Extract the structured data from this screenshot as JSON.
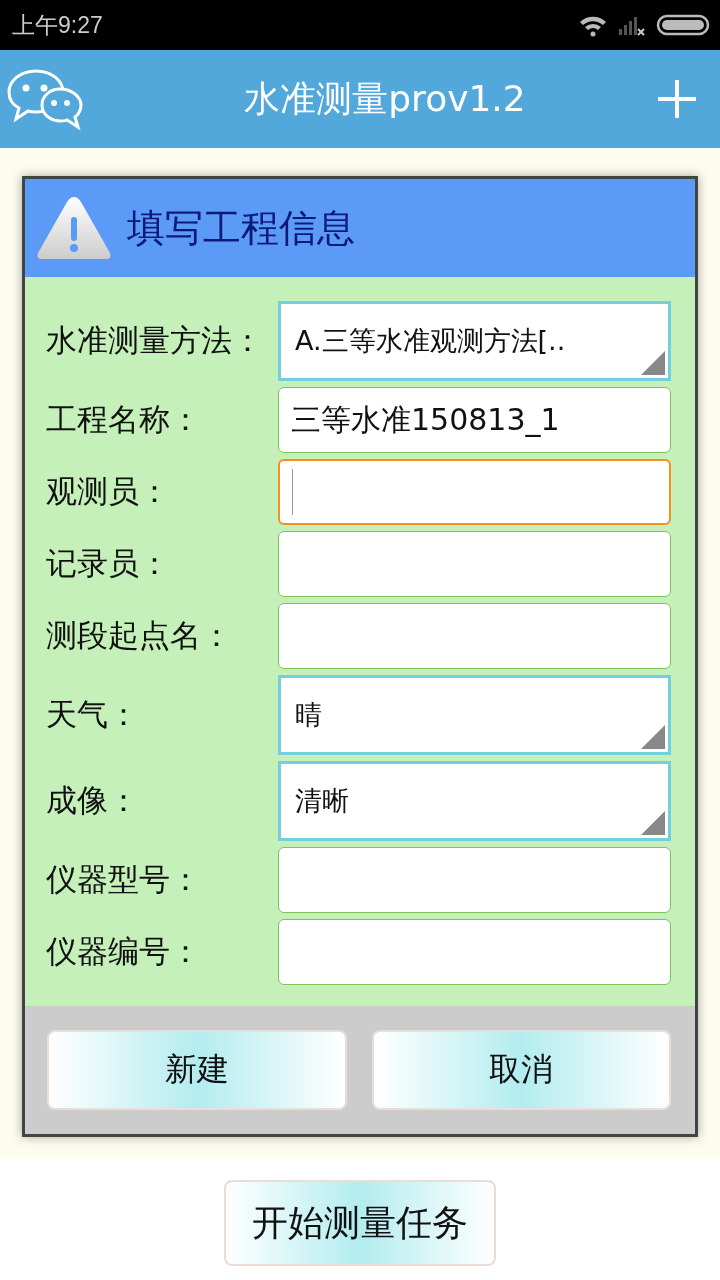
{
  "status_bar": {
    "time": "上午9:27"
  },
  "app_bar": {
    "title": "水准测量prov1.2"
  },
  "dialog": {
    "title": "填写工程信息",
    "fields": [
      {
        "label": "水准测量方法：",
        "kind": "select",
        "value": "A.三等水准观测方法[..",
        "focused": false
      },
      {
        "label": "工程名称：",
        "kind": "text",
        "value": "三等水准150813_1",
        "focused": false
      },
      {
        "label": "观测员：",
        "kind": "text",
        "focused": true
      },
      {
        "label": "记录员：",
        "kind": "text",
        "focused": false
      },
      {
        "label": "测段起点名：",
        "kind": "text",
        "focused": false
      },
      {
        "label": "天气：",
        "kind": "select",
        "value": "晴",
        "focused": false
      },
      {
        "label": "成像：",
        "kind": "select",
        "value": "清晰",
        "focused": false
      },
      {
        "label": "仪器型号：",
        "kind": "text",
        "focused": false
      },
      {
        "label": "仪器编号：",
        "kind": "text",
        "focused": false
      }
    ],
    "buttons": [
      "新建",
      "取消"
    ]
  },
  "main_button": "开始测量任务"
}
